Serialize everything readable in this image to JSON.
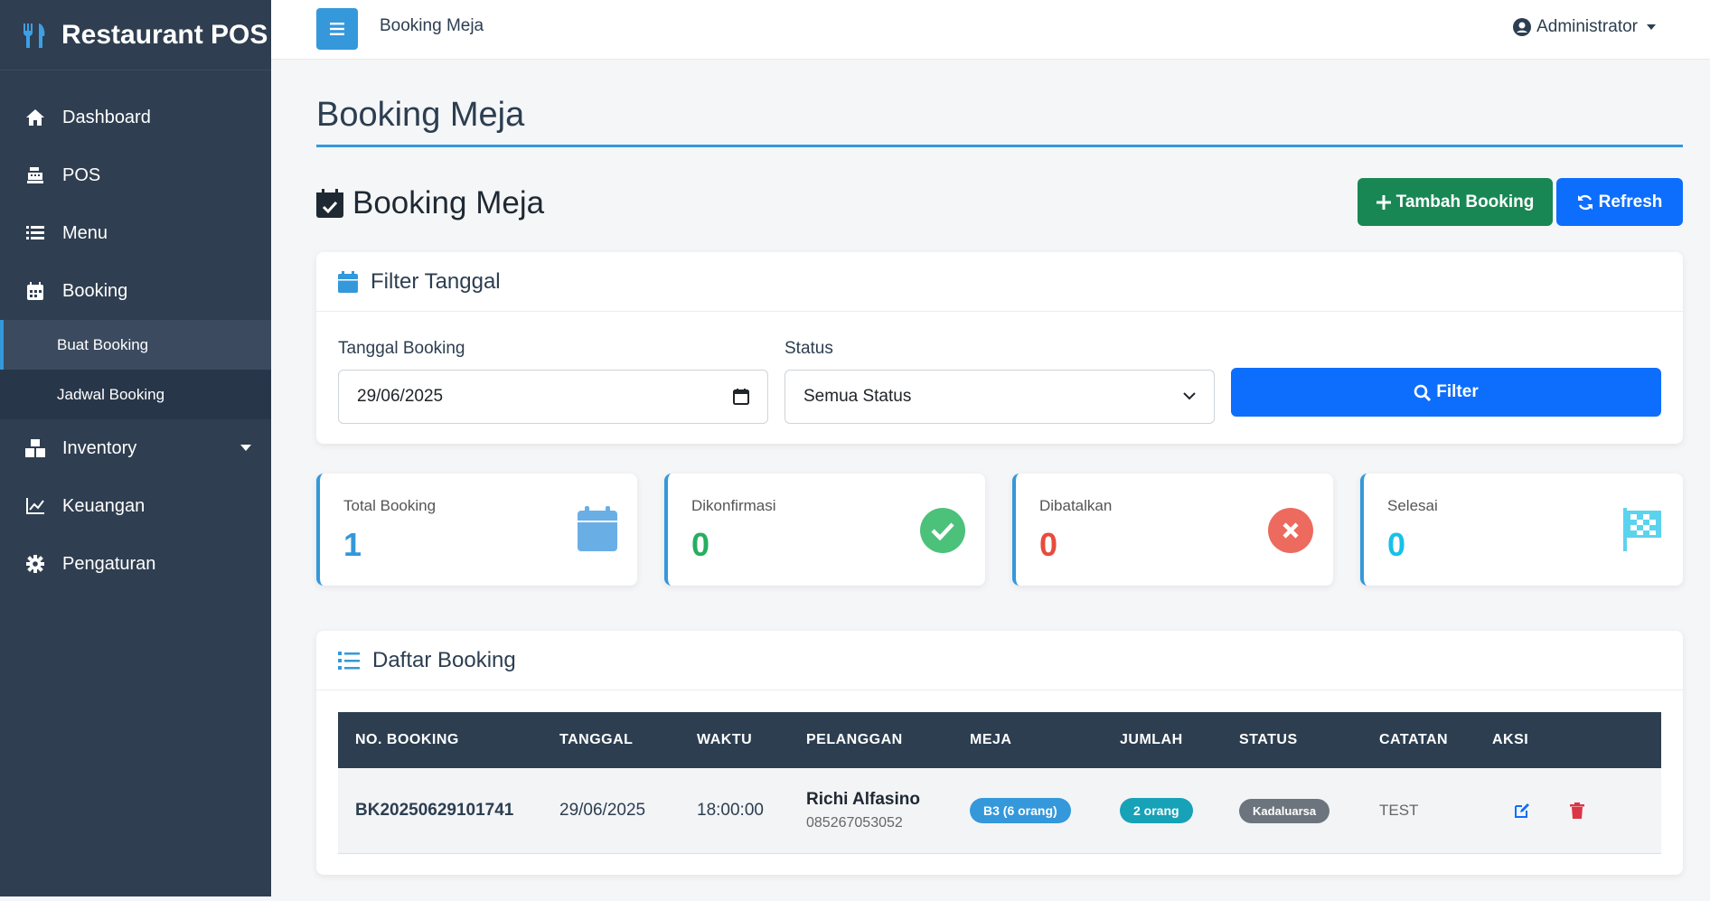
{
  "app": {
    "title": "Restaurant POS"
  },
  "sidebar": {
    "items": [
      {
        "label": "Dashboard"
      },
      {
        "label": "POS"
      },
      {
        "label": "Menu"
      },
      {
        "label": "Booking"
      },
      {
        "label": "Inventory"
      },
      {
        "label": "Keuangan"
      },
      {
        "label": "Pengaturan"
      }
    ],
    "booking_sub": [
      {
        "label": "Buat Booking"
      },
      {
        "label": "Jadwal Booking"
      }
    ]
  },
  "topbar": {
    "breadcrumb": "Booking Meja",
    "user": "Administrator"
  },
  "page": {
    "heading": "Booking Meja",
    "section_title": "Booking Meja"
  },
  "actions": {
    "add_label": "Tambah Booking",
    "refresh_label": "Refresh"
  },
  "filter": {
    "title": "Filter Tanggal",
    "date_label": "Tanggal Booking",
    "date_value": "29/06/2025",
    "status_label": "Status",
    "status_value": "Semua Status",
    "button_label": "Filter"
  },
  "stats": [
    {
      "label": "Total Booking",
      "value": "1",
      "color": "#3498db",
      "icon": "calendar-icon"
    },
    {
      "label": "Dikonfirmasi",
      "value": "0",
      "color": "#27ae60",
      "icon": "check-circle-icon"
    },
    {
      "label": "Dibatalkan",
      "value": "0",
      "color": "#e74c3c",
      "icon": "x-circle-icon"
    },
    {
      "label": "Selesai",
      "value": "0",
      "color": "#17c1e8",
      "icon": "flag-checkered-icon"
    }
  ],
  "list": {
    "title": "Daftar Booking",
    "columns": [
      "NO. BOOKING",
      "TANGGAL",
      "WAKTU",
      "PELANGGAN",
      "MEJA",
      "JUMLAH",
      "STATUS",
      "CATATAN",
      "AKSI"
    ],
    "rows": [
      {
        "no": "BK20250629101741",
        "tanggal": "29/06/2025",
        "waktu": "18:00:00",
        "pelanggan": "Richi Alfasino",
        "telepon": "085267053052",
        "meja": "B3 (6 orang)",
        "jumlah": "2 orang",
        "status": "Kadaluarsa",
        "catatan": "TEST"
      }
    ]
  },
  "colors": {
    "sidebar": "#2f3e50",
    "accent": "#3498db",
    "success": "#198754",
    "primary": "#0d6efd",
    "table_header": "#2c3e50",
    "badge_meja": "#3498db",
    "badge_jumlah": "#17a2b8",
    "badge_status": "#6c757d"
  }
}
